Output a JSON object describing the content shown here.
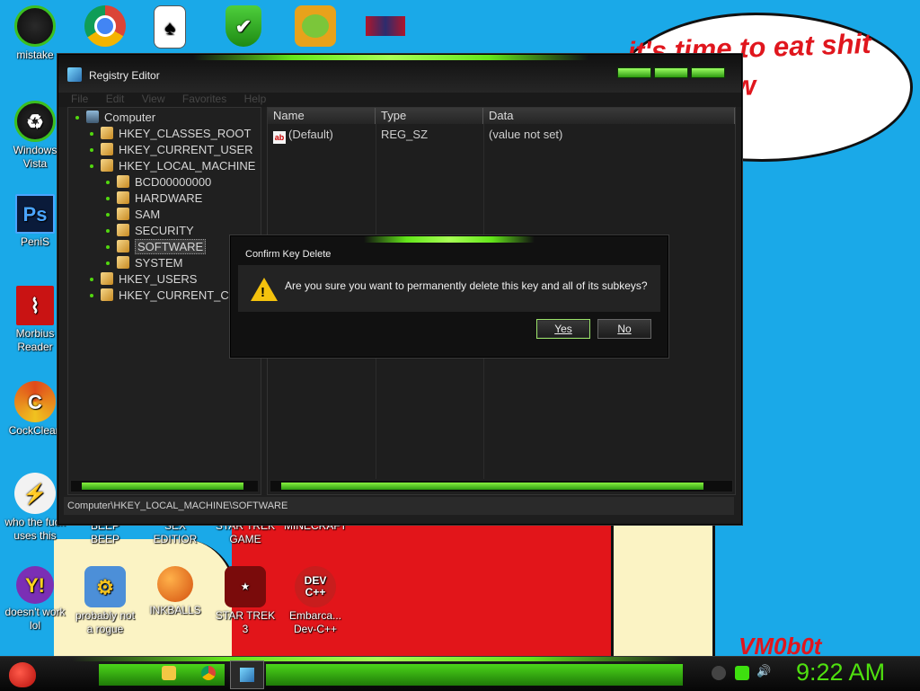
{
  "wallpaper": {
    "speech_text": "it's time to eat shit\nand chew\ngum",
    "signature": "VM0b0t"
  },
  "desktop_icons": [
    {
      "label": "mistake",
      "icon": "green-orb-icon"
    },
    {
      "label": "Windows\nVista",
      "icon": "recycle-bin-icon"
    },
    {
      "label": "PeniS",
      "icon": "photoshop-icon"
    },
    {
      "label": "Morbius\nReader",
      "icon": "pdf-reader-icon"
    },
    {
      "label": "CockClean",
      "icon": "ccleaner-icon"
    },
    {
      "label": "who the fuck\nuses this",
      "icon": "lightning-icon"
    },
    {
      "label": "doesn't work\nlol",
      "icon": "yahoo-messenger-icon"
    },
    {
      "label": "probably not\na rogue",
      "icon": "gears-icon"
    },
    {
      "label": "INKBALLS",
      "icon": "inkball-icon"
    },
    {
      "label": "STAR TREK\n3",
      "icon": "star-trek-icon"
    },
    {
      "label": "Embarca...\nDev-C++",
      "icon": "devcpp-icon"
    },
    {
      "label": "BEEP\nBEEP",
      "icon": "app-icon"
    },
    {
      "label": "SEX\nEDITIOR",
      "icon": "app-icon"
    },
    {
      "label": "STAR TREK\nGAME",
      "icon": "app-icon"
    },
    {
      "label": "MINECRAFT",
      "icon": "app-icon"
    }
  ],
  "top_icons": [
    "console-icon",
    "chrome-icon",
    "solitaire-icon",
    "shield-check-icon",
    "angry-birds-pig-icon",
    "winrar-icon"
  ],
  "registry": {
    "title": "Registry Editor",
    "menu": [
      "File",
      "Edit",
      "View",
      "Favorites",
      "Help"
    ],
    "tree": {
      "root": "Computer",
      "items": [
        {
          "label": "HKEY_CLASSES_ROOT",
          "depth": 1
        },
        {
          "label": "HKEY_CURRENT_USER",
          "depth": 1
        },
        {
          "label": "HKEY_LOCAL_MACHINE",
          "depth": 1
        },
        {
          "label": "BCD00000000",
          "depth": 2
        },
        {
          "label": "HARDWARE",
          "depth": 2
        },
        {
          "label": "SAM",
          "depth": 2
        },
        {
          "label": "SECURITY",
          "depth": 2
        },
        {
          "label": "SOFTWARE",
          "depth": 2,
          "selected": true
        },
        {
          "label": "SYSTEM",
          "depth": 2
        },
        {
          "label": "HKEY_USERS",
          "depth": 1
        },
        {
          "label": "HKEY_CURRENT_CONFIG",
          "depth": 1
        }
      ]
    },
    "columns": [
      "Name",
      "Type",
      "Data"
    ],
    "rows": [
      {
        "name": "(Default)",
        "type": "REG_SZ",
        "data": "(value not set)"
      }
    ],
    "status_path": "Computer\\HKEY_LOCAL_MACHINE\\SOFTWARE"
  },
  "dialog": {
    "title": "Confirm Key Delete",
    "message": "Are you sure you want to permanently delete this key and all of its subkeys?",
    "yes_label": "Yes",
    "no_label": "No"
  },
  "taskbar": {
    "clock": "9:22 AM",
    "accent_color": "#4fe00f"
  }
}
